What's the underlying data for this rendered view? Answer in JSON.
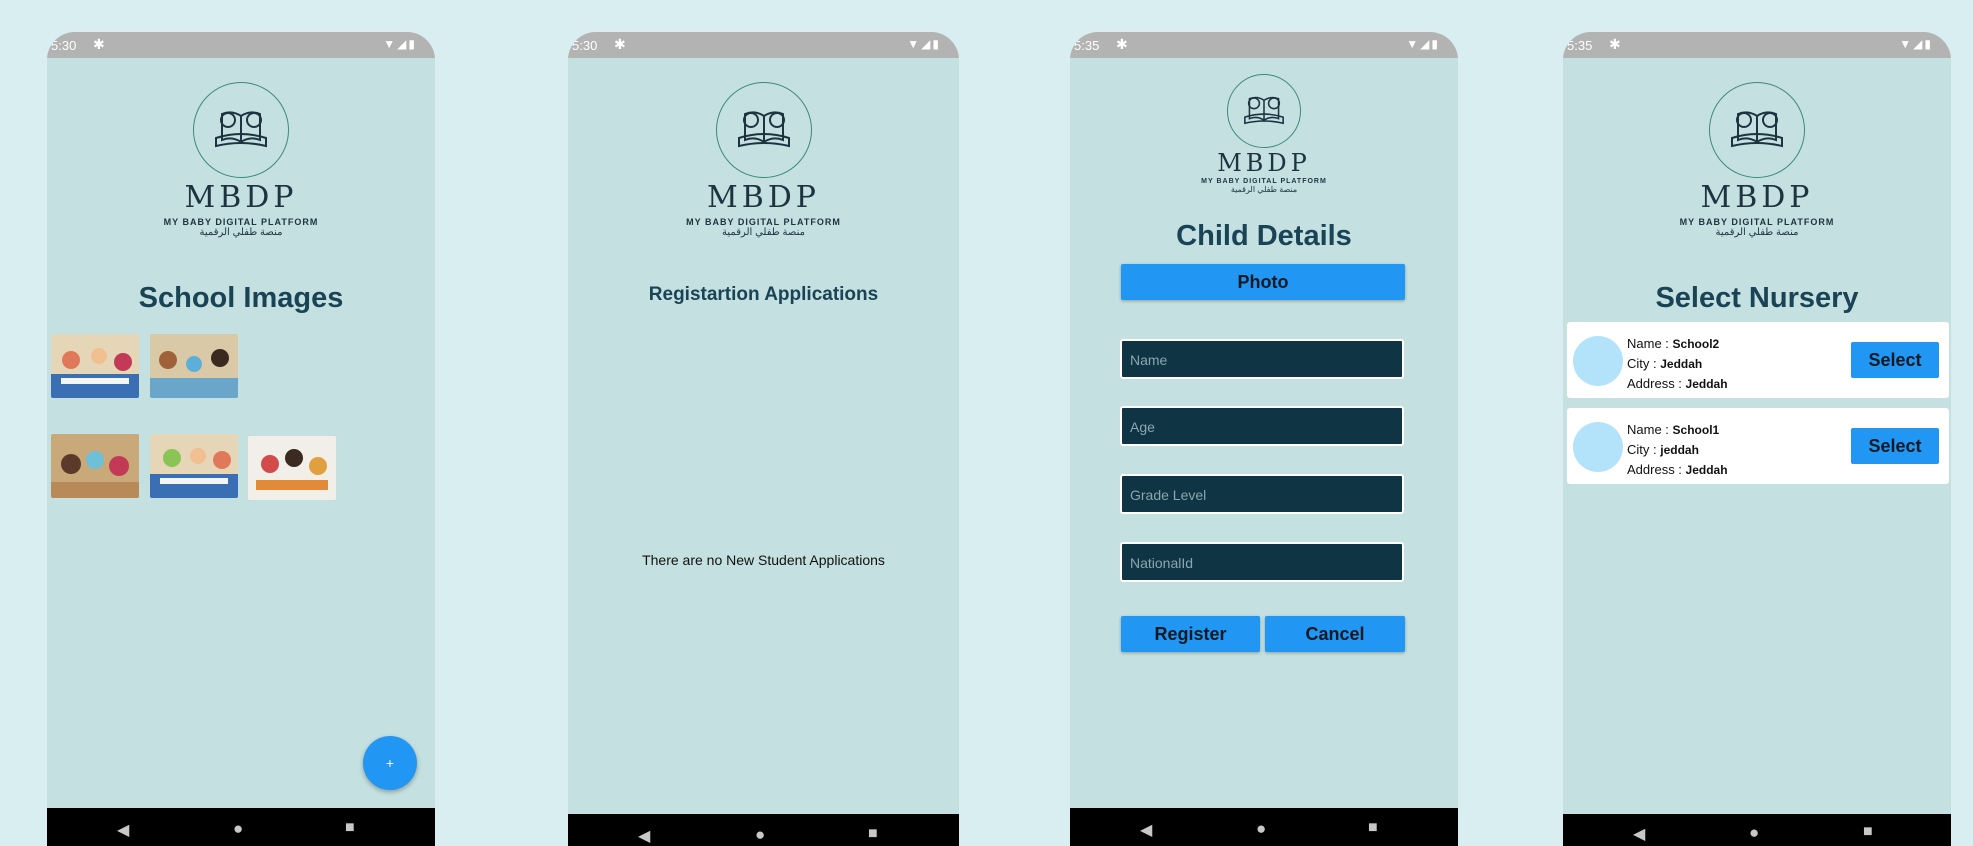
{
  "logo": {
    "title": "MBDP",
    "subtitle": "MY BABY DIGITAL PLATFORM",
    "arabic": "منصة طفلي الرقمية"
  },
  "screens": [
    {
      "status_time": "5:30",
      "heading": "School Images",
      "fab_icon": "+"
    },
    {
      "status_time": "5:30",
      "heading": "Registartion Applications",
      "empty_message": "There are no New Student Applications"
    },
    {
      "status_time": "5:35",
      "heading": "Child Details",
      "photo_button": "Photo",
      "fields": [
        {
          "placeholder": "Name"
        },
        {
          "placeholder": "Age"
        },
        {
          "placeholder": "Grade Level"
        },
        {
          "placeholder": "NationalId"
        }
      ],
      "register_button": "Register",
      "cancel_button": "Cancel"
    },
    {
      "status_time": "5:35",
      "heading": "Select Nursery",
      "nurseries": [
        {
          "name_label": "Name :",
          "name": "School2",
          "city_label": "City :",
          "city": "Jeddah",
          "address_label": "Address :",
          "address": "Jeddah",
          "button": "Select"
        },
        {
          "name_label": "Name :",
          "name": "School1",
          "city_label": "City :",
          "city": "jeddah",
          "address_label": "Address :",
          "address": "Jeddah",
          "button": "Select"
        }
      ]
    }
  ],
  "icons": {
    "settings": "gear-icon",
    "wifi": "wifi-icon",
    "signal": "signal-icon",
    "battery": "battery-icon",
    "back": "back-icon",
    "home": "home-icon",
    "recents": "recents-icon",
    "add": "add-icon"
  },
  "colors": {
    "screen_bg": "#c4e0e0",
    "page_bg": "#d8eef0",
    "accent": "#2196f3",
    "heading": "#1a4456",
    "field_bg": "#0f3544"
  }
}
